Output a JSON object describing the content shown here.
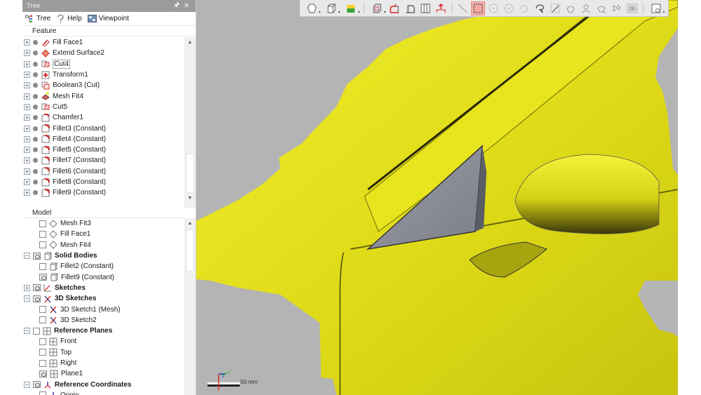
{
  "panel": {
    "title": "Tree",
    "pin_icon": "pin-icon",
    "close_icon": "close-icon",
    "tabs": [
      {
        "label": "Tree",
        "icon": "tree-icon"
      },
      {
        "label": "Help",
        "icon": "help-icon"
      },
      {
        "label": "Viewpoint",
        "icon": "viewpoint-icon"
      }
    ],
    "feature_header": "Feature",
    "features": [
      {
        "label": "Fill Face1",
        "icon": "fill-face-icon"
      },
      {
        "label": "Extend Surface2",
        "icon": "extend-surface-icon"
      },
      {
        "label": "Cut4",
        "icon": "cut-icon",
        "selected": true
      },
      {
        "label": "Transform1",
        "icon": "transform-icon"
      },
      {
        "label": "Boolean3 (Cut)",
        "icon": "boolean-icon"
      },
      {
        "label": "Mesh Fit4",
        "icon": "mesh-fit-icon"
      },
      {
        "label": "Cut5",
        "icon": "cut-icon"
      },
      {
        "label": "Chamfer1",
        "icon": "chamfer-icon"
      },
      {
        "label": "Fillet3 (Constant)",
        "icon": "fillet-icon"
      },
      {
        "label": "Fillet4 (Constant)",
        "icon": "fillet-icon"
      },
      {
        "label": "Fillet5 (Constant)",
        "icon": "fillet-icon"
      },
      {
        "label": "Fillet7 (Constant)",
        "icon": "fillet-icon"
      },
      {
        "label": "Fillet6 (Constant)",
        "icon": "fillet-icon"
      },
      {
        "label": "Fillet8 (Constant)",
        "icon": "fillet-icon"
      },
      {
        "label": "Fillet9 (Constant)",
        "icon": "fillet-icon"
      }
    ],
    "model_header": "Model",
    "model": [
      {
        "label": "Mesh Fit3",
        "level": 1,
        "vis": "off",
        "icon": "surface-icon"
      },
      {
        "label": "Fill Face1",
        "level": 1,
        "vis": "off",
        "icon": "surface-icon"
      },
      {
        "label": "Mesh Fit4",
        "level": 1,
        "vis": "off",
        "icon": "surface-icon"
      },
      {
        "label": "Solid Bodies",
        "level": 0,
        "vis": "on",
        "icon": "solid-body-icon",
        "expanded": true,
        "bold": true
      },
      {
        "label": "Fillet2 (Constant)",
        "level": 1,
        "vis": "off",
        "icon": "solid-body-icon"
      },
      {
        "label": "Fillet9 (Constant)",
        "level": 1,
        "vis": "on",
        "icon": "solid-body-icon"
      },
      {
        "label": "Sketches",
        "level": 0,
        "vis": "on",
        "icon": "sketch-icon",
        "expanded": false,
        "bold": true
      },
      {
        "label": "3D Sketches",
        "level": 0,
        "vis": "on",
        "icon": "3d-sketch-icon",
        "expanded": true,
        "bold": true
      },
      {
        "label": "3D Sketch1 (Mesh)",
        "level": 1,
        "vis": "off",
        "icon": "3d-sketch-icon"
      },
      {
        "label": "3D Sketch2",
        "level": 1,
        "vis": "off",
        "icon": "3d-sketch-icon"
      },
      {
        "label": "Reference Planes",
        "level": 0,
        "vis": "off",
        "icon": "plane-icon",
        "expanded": true,
        "bold": true
      },
      {
        "label": "Front",
        "level": 1,
        "vis": "off",
        "icon": "plane-icon"
      },
      {
        "label": "Top",
        "level": 1,
        "vis": "off",
        "icon": "plane-icon"
      },
      {
        "label": "Right",
        "level": 1,
        "vis": "off",
        "icon": "plane-icon"
      },
      {
        "label": "Plane1",
        "level": 1,
        "vis": "on",
        "icon": "plane-icon"
      },
      {
        "label": "Reference Coordinates",
        "level": 0,
        "vis": "on",
        "icon": "coordinate-icon",
        "expanded": true,
        "bold": true
      },
      {
        "label": "Origin",
        "level": 1,
        "vis": "off",
        "icon": "coordinate-icon"
      }
    ]
  },
  "viewport": {
    "toolbar": [
      {
        "name": "view-style",
        "icon": "polyhedron-icon",
        "dropdown": true
      },
      {
        "name": "view-orientation",
        "icon": "cube-icon",
        "dropdown": true
      },
      {
        "name": "display-mode",
        "icon": "shaded-cube-icon",
        "dropdown": true
      },
      {
        "sep": true
      },
      {
        "name": "section-view",
        "icon": "section-box-icon",
        "dropdown": true
      },
      {
        "name": "clip-plane",
        "icon": "clip-red-icon"
      },
      {
        "name": "clip-plane-2",
        "icon": "clip-icon"
      },
      {
        "name": "split-view",
        "icon": "split-icon"
      },
      {
        "name": "home-view",
        "icon": "home-arrow-icon"
      },
      {
        "sep": true
      },
      {
        "name": "line-select",
        "icon": "line-select-icon"
      },
      {
        "name": "rect-select",
        "icon": "rect-select-icon",
        "active": true
      },
      {
        "name": "circle-select",
        "icon": "circle-select-icon"
      },
      {
        "name": "poly-select",
        "icon": "polygon-select-icon"
      },
      {
        "name": "freeform-select",
        "icon": "freeform-select-icon"
      },
      {
        "name": "lasso-select",
        "icon": "lasso-select-icon"
      },
      {
        "name": "paint-select",
        "icon": "paint-select-icon"
      },
      {
        "name": "visible-select",
        "icon": "visible-select-icon"
      },
      {
        "name": "select-through",
        "icon": "select-through-icon"
      },
      {
        "name": "select-filter",
        "icon": "select-filter-icon"
      },
      {
        "name": "transform-toggle",
        "icon": "transform-toggle-icon"
      },
      {
        "name": "eye-toggle",
        "icon": "eye-icon"
      },
      {
        "sep": true
      },
      {
        "name": "view-options",
        "icon": "view-options-icon",
        "dropdown": true
      }
    ],
    "scale_label": "50 mm",
    "axes": {
      "x": "X",
      "y": "Y",
      "z": "Z"
    },
    "colors": {
      "background": "#b4b4b4",
      "mesh": "#e6e21a",
      "face": "#8c8e96"
    }
  }
}
